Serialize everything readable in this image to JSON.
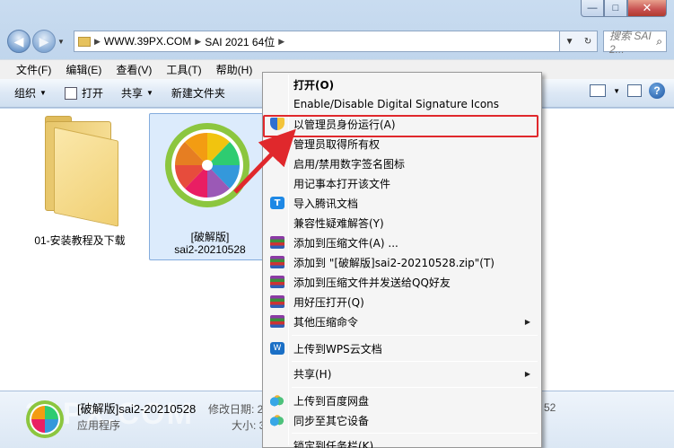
{
  "window": {
    "caption": {
      "minimize": "—",
      "maximize": "□",
      "close": "✕"
    }
  },
  "nav": {
    "back_icon": "back-arrow-icon",
    "forward_icon": "forward-arrow-icon",
    "breadcrumb": [
      "WWW.39PX.COM",
      "SAI 2021 64位"
    ],
    "search_placeholder": "搜索 SAI 2..."
  },
  "menubar": [
    "文件(F)",
    "编辑(E)",
    "查看(V)",
    "工具(T)",
    "帮助(H)"
  ],
  "cmdbar": {
    "organize": "组织",
    "open": "打开",
    "share": "共享",
    "new_folder": "新建文件夹"
  },
  "files": [
    {
      "name": "01-安装教程及下载",
      "icon": "folder-icon"
    },
    {
      "name_line1": "[破解版]",
      "name_line2": "sai2-20210528",
      "icon": "sai-app-icon",
      "selected": true
    }
  ],
  "context_menu": {
    "items": [
      {
        "label": "打开(O)",
        "bold": true,
        "icon": ""
      },
      {
        "label": "Enable/Disable Digital Signature Icons",
        "icon": ""
      },
      {
        "label": "以管理员身份运行(A)",
        "icon": "uac-shield-icon",
        "highlighted": true
      },
      {
        "label": "管理员取得所有权",
        "icon": ""
      },
      {
        "label": "启用/禁用数字签名图标",
        "icon": ""
      },
      {
        "label": "用记事本打开该文件",
        "icon": ""
      },
      {
        "label": "导入腾讯文档",
        "icon": "tencent-docs-icon"
      },
      {
        "label": "兼容性疑难解答(Y)",
        "icon": ""
      },
      {
        "label": "添加到压缩文件(A) ...",
        "icon": "winrar-icon"
      },
      {
        "label": "添加到 \"[破解版]sai2-20210528.zip\"(T)",
        "icon": "winrar-icon"
      },
      {
        "label": "添加到压缩文件并发送给QQ好友",
        "icon": "winrar-icon"
      },
      {
        "label": "用好压打开(Q)",
        "icon": "winrar-icon"
      },
      {
        "label": "其他压缩命令",
        "icon": "winrar-icon",
        "submenu": true
      },
      {
        "label": "上传到WPS云文档",
        "icon": "wps-icon"
      },
      {
        "label": "共享(H)",
        "icon": "",
        "submenu": true
      },
      {
        "label": "上传到百度网盘",
        "icon": "baidu-cloud-icon"
      },
      {
        "label": "同步至其它设备",
        "icon": "baidu-cloud-icon"
      },
      {
        "label": "锁定到任务栏(K)",
        "icon": ""
      }
    ]
  },
  "status": {
    "name": "[破解版]sai2-20210528",
    "type": "应用程序",
    "modified_key": "修改日期: 2",
    "size_key": "大小: 3",
    "right_value": "52",
    "watermark": "39PX.COM"
  },
  "colors": {
    "highlight_box": "#e0282c",
    "arrow": "#e0282c",
    "selection": "#dcebfc"
  }
}
